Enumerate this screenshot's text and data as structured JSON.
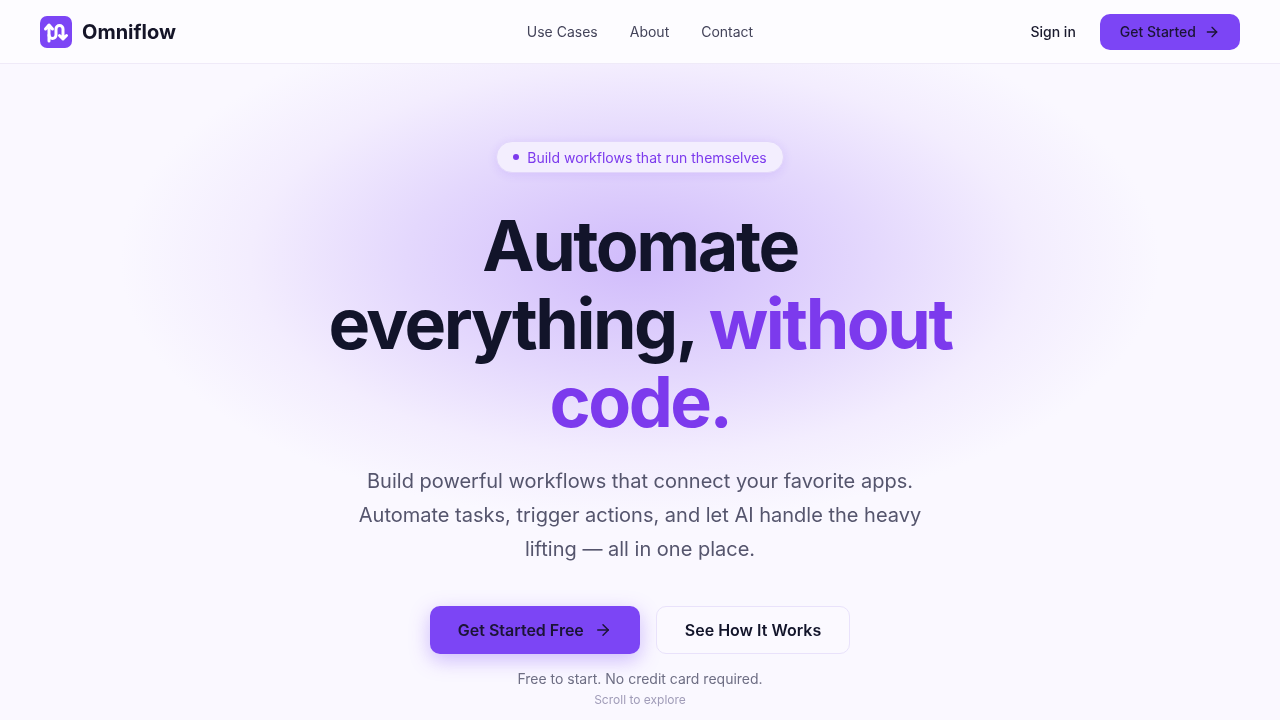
{
  "header": {
    "brand": "Omniflow",
    "nav": [
      "Use Cases",
      "About",
      "Contact"
    ],
    "sign_in": "Sign in",
    "cta": "Get Started"
  },
  "hero": {
    "badge": "Build workflows that run themselves",
    "headline_lines": [
      [
        {
          "text": "Automate",
          "accent": false
        }
      ],
      [
        {
          "text": "everything,",
          "accent": false
        },
        {
          "text": "without",
          "accent": true
        }
      ],
      [
        {
          "text": "code.",
          "accent": true
        }
      ]
    ],
    "subtitle": "Build powerful workflows that connect your favorite apps. Automate tasks, trigger actions, and let AI handle the heavy lifting — all in one place.",
    "primary_button": "Get Started Free",
    "secondary_button": "See How It Works",
    "note": "Free to start. No credit card required.",
    "scroll_hint": "Scroll to explore"
  }
}
